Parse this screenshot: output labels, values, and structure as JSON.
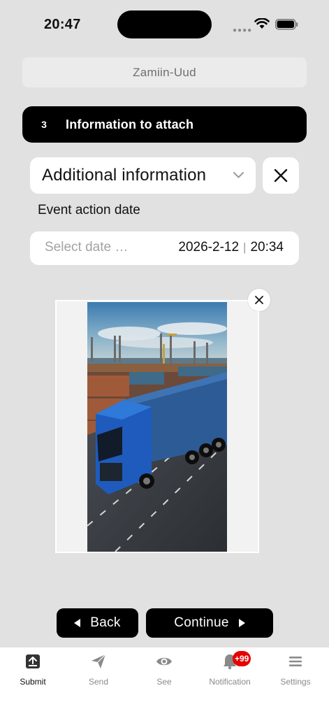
{
  "status_bar": {
    "time": "20:47"
  },
  "header": {
    "title": "Zamiin-Uud"
  },
  "step": {
    "number": "3",
    "title": "Information to attach"
  },
  "attachment_type": {
    "selected": "Additional information"
  },
  "date_field": {
    "label": "Event action date",
    "placeholder": "Select date …",
    "date": "2026-2-12",
    "separator": "|",
    "time": "20:34"
  },
  "buttons": {
    "back": "Back",
    "continue": "Continue"
  },
  "tabs": [
    {
      "label": "Submit",
      "icon": "upload-icon",
      "active": true
    },
    {
      "label": "Send",
      "icon": "send-icon"
    },
    {
      "label": "See",
      "icon": "eye-icon"
    },
    {
      "label": "Notification",
      "icon": "bell-icon",
      "badge": "+99"
    },
    {
      "label": "Settings",
      "icon": "menu-icon"
    }
  ],
  "colors": {
    "background": "#e1e1e1",
    "primary": "#000000",
    "badge": "#e60000",
    "surface": "#ffffff"
  }
}
